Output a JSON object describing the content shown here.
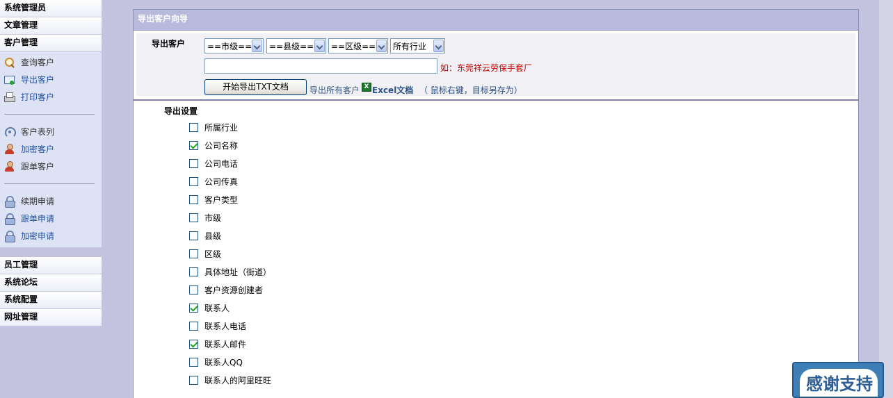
{
  "sidebar": {
    "top_sections": [
      "系统管理员",
      "文章管理",
      "客户管理"
    ],
    "customer_groups": [
      [
        {
          "label": "查询客户",
          "icon": "search-icon",
          "color": "gray"
        },
        {
          "label": "导出客户",
          "icon": "export-icon",
          "color": "blue"
        },
        {
          "label": "打印客户",
          "icon": "printer-icon",
          "color": "blue"
        }
      ],
      [
        {
          "label": "客户表列",
          "icon": "signal-icon",
          "color": "gray"
        },
        {
          "label": "加密客户",
          "icon": "user-icon",
          "color": "blue"
        },
        {
          "label": "跟单客户",
          "icon": "user-icon",
          "color": "gray"
        }
      ],
      [
        {
          "label": "续期申请",
          "icon": "lock-icon",
          "color": "gray"
        },
        {
          "label": "跟单申请",
          "icon": "lock-icon",
          "color": "blue"
        },
        {
          "label": "加密申请",
          "icon": "lock-icon",
          "color": "blue"
        }
      ]
    ],
    "bottom_sections": [
      "员工管理",
      "系统论坛",
      "系统配置",
      "网址管理"
    ]
  },
  "main": {
    "title": "导出客户向导",
    "filter": {
      "label": "导出客户",
      "selects": [
        "==市级==",
        "==县级==",
        "==区级==",
        "所有行业"
      ],
      "name_value": "",
      "hint": "如：东莞祥云劳保手套厂",
      "export_button": "开始导出TXT文档",
      "export_all_link": "导出所有客户",
      "excel_icon": "excel-icon",
      "excel_link": "Excel文档",
      "excel_note": "（ 鼠标右键，目标另存为）"
    },
    "settings": {
      "title": "导出设置",
      "options": [
        {
          "label": "所属行业",
          "checked": false
        },
        {
          "label": "公司名称",
          "checked": true
        },
        {
          "label": "公司电话",
          "checked": false
        },
        {
          "label": "公司传真",
          "checked": false
        },
        {
          "label": "客户类型",
          "checked": false
        },
        {
          "label": "市级",
          "checked": false
        },
        {
          "label": "县级",
          "checked": false
        },
        {
          "label": "区级",
          "checked": false
        },
        {
          "label": "具体地址（街道）",
          "checked": false
        },
        {
          "label": "客户资源创建者",
          "checked": false
        },
        {
          "label": "联系人",
          "checked": true
        },
        {
          "label": "联系人电话",
          "checked": false
        },
        {
          "label": "联系人邮件",
          "checked": true
        },
        {
          "label": "联系人QQ",
          "checked": false
        },
        {
          "label": "联系人的阿里旺旺",
          "checked": false
        }
      ]
    }
  },
  "thanks_badge": "感谢支持"
}
